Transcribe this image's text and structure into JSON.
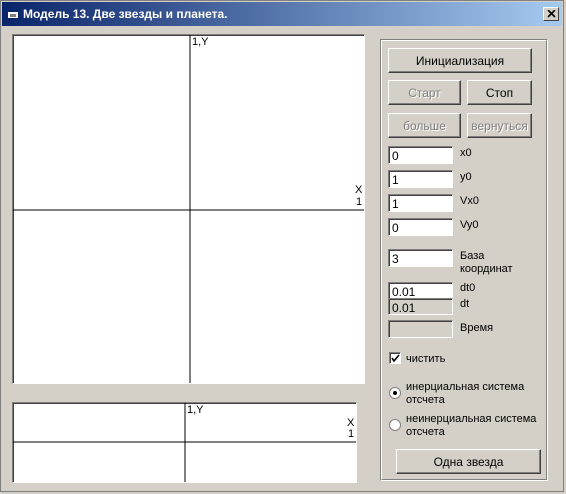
{
  "window": {
    "title": "Модель 13. Две звезды и планета.",
    "title_icon": "app-icon",
    "close_icon": "close-icon"
  },
  "main_plot": {
    "y_axis_label": "1,Y",
    "x_axis_label": "X",
    "x_axis_value": "1"
  },
  "small_plot": {
    "y_axis_label": "1,Y",
    "x_axis_label": "X",
    "x_axis_value": "1"
  },
  "controls": {
    "init_button": "Инициализация",
    "start_button": "Старт",
    "stop_button": "Стоп",
    "more_button": "больше",
    "back_button": "вернуться",
    "x0": {
      "value": "0",
      "label": "x0"
    },
    "y0": {
      "value": "1",
      "label": "y0"
    },
    "vx0": {
      "value": "1",
      "label": "Vx0"
    },
    "vy0": {
      "value": "0",
      "label": "Vy0"
    },
    "base": {
      "value": "3",
      "label_line1": "База",
      "label_line2": "координат"
    },
    "dt0": {
      "value": "0.01",
      "label": "dt0"
    },
    "dt": {
      "value": "0.01",
      "label": "dt"
    },
    "time": {
      "value": "",
      "label": "Время"
    },
    "clear_checkbox": {
      "label": "чистить",
      "checked": true
    },
    "inertial_radio": {
      "label_line1": "инерциальная система",
      "label_line2": "отсчета",
      "selected": true
    },
    "noninertial_radio": {
      "label_line1": "неинерциальная система",
      "label_line2": "отсчета",
      "selected": false
    },
    "one_star_button": "Одна звезда"
  }
}
